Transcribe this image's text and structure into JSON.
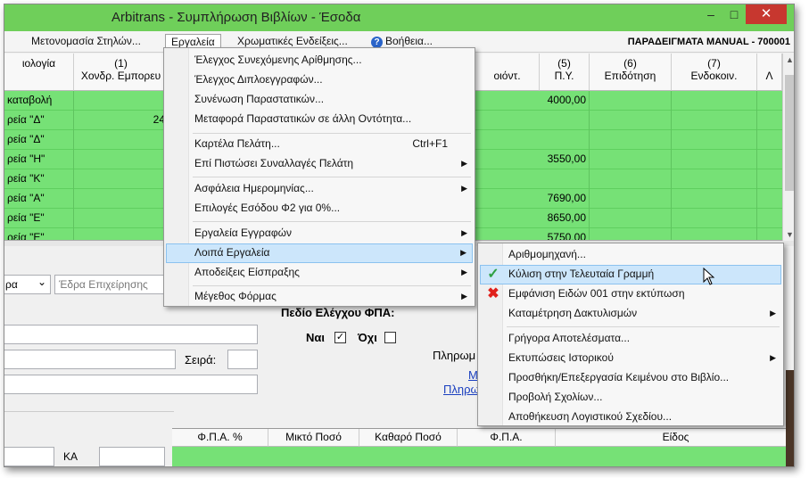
{
  "window": {
    "title": "Arbitrans - Συμπλήρωση Βιβλίων - Έσοδα",
    "min": "–",
    "max": "□",
    "close": "✕"
  },
  "menubar": {
    "items": [
      "Μετονομασία Στηλών...",
      "Εργαλεία",
      "Χρωματικές Ενδείξεις...",
      "Βοήθεια..."
    ],
    "company": "ΠΑΡΑΔΕΙΓΜΑΤΑ MANUAL - 700001"
  },
  "grid": {
    "headers": [
      {
        "n": "",
        "label": "ιολογία"
      },
      {
        "n": "(1)",
        "label": "Χονδρ. Εμπορευ"
      },
      {
        "n": "",
        "label": "οιόντ."
      },
      {
        "n": "(5)",
        "label": "Π.Υ."
      },
      {
        "n": "(6)",
        "label": "Επιδότηση"
      },
      {
        "n": "(7)",
        "label": "Ενδοκοιν."
      },
      {
        "n": "",
        "label": "Λ"
      }
    ],
    "rows": [
      {
        "c0": "καταβολή",
        "c1": "",
        "c5": "4000,00"
      },
      {
        "c0": "ρεία \"Δ\"",
        "c1": "24",
        "c5": ""
      },
      {
        "c0": "ρεία \"Δ\"",
        "c1": "",
        "c5": ""
      },
      {
        "c0": "ρεία \"Η\"",
        "c1": "",
        "c5": "3550,00"
      },
      {
        "c0": "ρεία \"Κ\"",
        "c1": "",
        "c5": ""
      },
      {
        "c0": "ρεία \"Α\"",
        "c1": "",
        "c5": "7690,00"
      },
      {
        "c0": "ρεία \"Ε\"",
        "c1": "",
        "c5": "8650,00"
      },
      {
        "c0": "ρεία \"Ε\"",
        "c1": "",
        "c5": "5750,00"
      }
    ]
  },
  "form": {
    "combo_value": "ρα",
    "combo_arrow": "⌄",
    "seat_placeholder": "Έδρα Επιχείρησης",
    "vat_title": "Πεδίο Ελέγχου ΦΠΑ:",
    "yes_label": "Ναι",
    "yes_checked": "✓",
    "no_label": "Όχι",
    "series_label": "Σειρά:",
    "payment_label": "Πληρωμ",
    "link1": "Μ",
    "link2": "Πληρωμ",
    "ka_label": "ΚΑ"
  },
  "bottom_grid": {
    "headers": [
      "Φ.Π.Α. %",
      "Μικτό Ποσό",
      "Καθαρό Ποσό",
      "Φ.Π.Α.",
      "Είδος"
    ]
  },
  "tools_menu": {
    "items": [
      {
        "label": "Έλεγχος Συνεχόμενης Αρίθμησης...",
        "shortcut": "",
        "sub": false
      },
      {
        "label": "Έλεγχος Διπλοεγγραφών...",
        "shortcut": "",
        "sub": false
      },
      {
        "label": "Συνένωση Παραστατικών...",
        "shortcut": "",
        "sub": false
      },
      {
        "label": "Μεταφορά Παραστατικών σε άλλη Οντότητα...",
        "shortcut": "",
        "sub": false
      },
      {
        "label": "Καρτέλα Πελάτη...",
        "shortcut": "Ctrl+F1",
        "sub": false
      },
      {
        "label": "Επί Πιστώσει Συναλλαγές Πελάτη",
        "shortcut": "",
        "sub": true
      },
      {
        "label": "Ασφάλεια Ημερομηνίας...",
        "shortcut": "",
        "sub": true
      },
      {
        "label": "Επιλογές Εσόδου Φ2 για 0%...",
        "shortcut": "",
        "sub": false
      },
      {
        "label": "Εργαλεία Εγγραφών",
        "shortcut": "",
        "sub": true
      },
      {
        "label": "Λοιπά Εργαλεία",
        "shortcut": "",
        "sub": true
      },
      {
        "label": "Αποδείξεις Είσπραξης",
        "shortcut": "",
        "sub": true
      },
      {
        "label": "Μέγεθος Φόρμας",
        "shortcut": "",
        "sub": true
      }
    ],
    "submenu_arrow": "▶"
  },
  "other_tools_menu": {
    "items": [
      {
        "label": "Αριθμομηχανή...",
        "sub": false,
        "icon": ""
      },
      {
        "label": "Κύλιση στην Τελευταία Γραμμή",
        "sub": false,
        "icon": "checkmark-icon"
      },
      {
        "label": "Εμφάνιση Ειδών 001 στην εκτύπωση",
        "sub": false,
        "icon": "red-x-icon"
      },
      {
        "label": "Καταμέτρηση Δακτυλισμών",
        "sub": true,
        "icon": ""
      },
      {
        "label": "Γρήγορα Αποτελέσματα...",
        "sub": false,
        "icon": ""
      },
      {
        "label": "Εκτυπώσεις Ιστορικού",
        "sub": true,
        "icon": ""
      },
      {
        "label": "Προσθήκη/Επεξεργασία Κειμένου στο Βιβλίο...",
        "sub": false,
        "icon": ""
      },
      {
        "label": "Προβολή Σχολίων...",
        "sub": false,
        "icon": ""
      },
      {
        "label": "Αποθήκευση Λογιστικού Σχεδίου...",
        "sub": false,
        "icon": ""
      }
    ],
    "check_glyph": "✓",
    "x_glyph": "✖"
  },
  "colors": {
    "title_bar": "#6fcf5a",
    "row_green": "#76e176",
    "highlight": "#cce6fb",
    "close_red": "#c7372f"
  }
}
